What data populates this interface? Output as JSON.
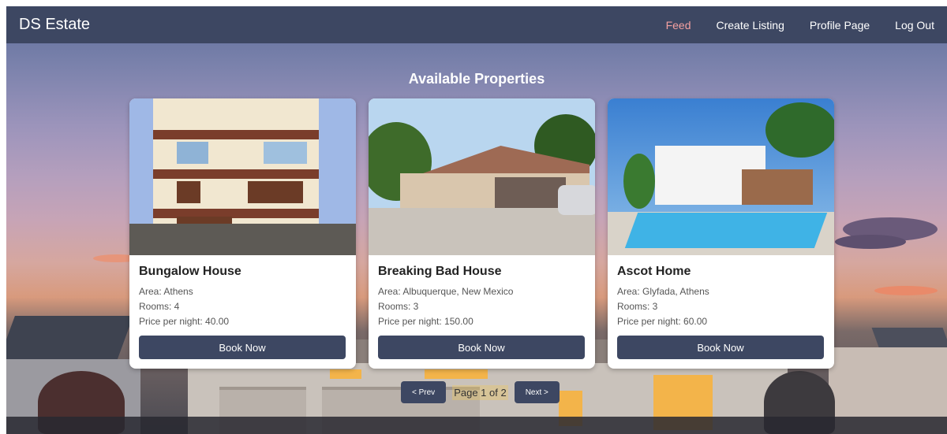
{
  "navbar": {
    "brand": "DS Estate",
    "links": [
      {
        "label": "Feed",
        "active": true
      },
      {
        "label": "Create Listing",
        "active": false
      },
      {
        "label": "Profile Page",
        "active": false
      },
      {
        "label": "Log Out",
        "active": false
      }
    ]
  },
  "main": {
    "heading": "Available Properties",
    "listings": [
      {
        "title": "Bungalow House",
        "area": "Area: Athens",
        "rooms": "Rooms: 4",
        "price": "Price per night: 40.00",
        "button": "Book Now"
      },
      {
        "title": "Breaking Bad House",
        "area": "Area: Albuquerque, New Mexico",
        "rooms": "Rooms: 3",
        "price": "Price per night: 150.00",
        "button": "Book Now"
      },
      {
        "title": "Ascot Home",
        "area": "Area: Glyfada, Athens",
        "rooms": "Rooms: 3",
        "price": "Price per night: 60.00",
        "button": "Book Now"
      }
    ]
  },
  "pagination": {
    "prev_label": "< Prev",
    "status": "Page 1 of 2",
    "next_label": "Next >"
  },
  "colors": {
    "navbar": "#3d4762",
    "active_link": "#f4a0a0",
    "button": "#3d4762"
  }
}
